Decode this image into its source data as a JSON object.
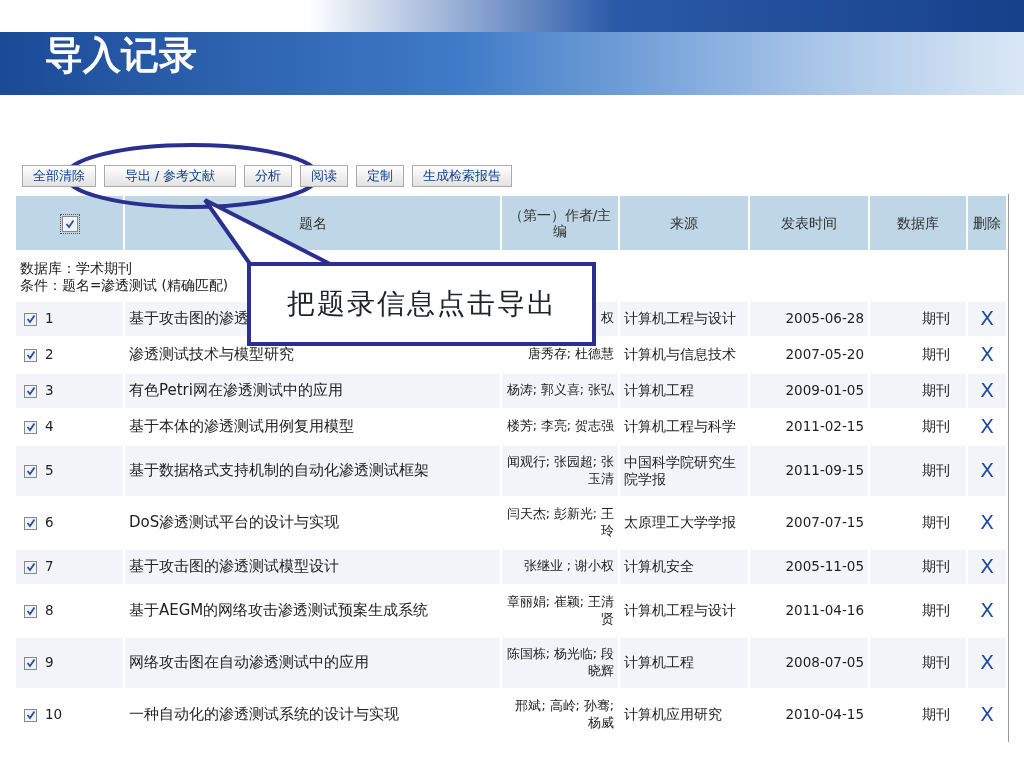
{
  "slide_title": "导入记录",
  "toolbar": {
    "buttons": [
      "全部清除",
      "导出 / 参考文献",
      "分析",
      "阅读",
      "定制",
      "生成检索报告"
    ]
  },
  "table": {
    "header_checkbox": {
      "checked": true
    },
    "columns": [
      "题名",
      "（第一）作者/主编",
      "来源",
      "发表时间",
      "数据库",
      "删除"
    ],
    "info": [
      "数据库：学术期刊",
      "条件：题名=渗透测试 (精确匹配)"
    ],
    "rows": [
      {
        "number": "1",
        "checked": true,
        "title": "基于攻击图的渗透",
        "author": "权",
        "source": "计算机工程与设计",
        "date": "2005-06-28",
        "database": "期刊",
        "delete": "X"
      },
      {
        "number": "2",
        "checked": true,
        "title": "渗透测试技术与模型研究",
        "author": "唐秀存; 杜德慧",
        "source": "计算机与信息技术",
        "date": "2007-05-20",
        "database": "期刊",
        "delete": "X"
      },
      {
        "number": "3",
        "checked": true,
        "title": "有色Petri网在渗透测试中的应用",
        "author": "杨涛; 郭义喜; 张弘",
        "source": "计算机工程",
        "date": "2009-01-05",
        "database": "期刊",
        "delete": "X"
      },
      {
        "number": "4",
        "checked": true,
        "title": "基于本体的渗透测试用例复用模型",
        "author": "楼芳; 李亮; 贺志强",
        "source": "计算机工程与科学",
        "date": "2011-02-15",
        "database": "期刊",
        "delete": "X"
      },
      {
        "number": "5",
        "checked": true,
        "title": "基于数据格式支持机制的自动化渗透测试框架",
        "author": "闻观行; 张园超; 张玉清",
        "source": "中国科学院研究生院学报",
        "date": "2011-09-15",
        "database": "期刊",
        "delete": "X"
      },
      {
        "number": "6",
        "checked": true,
        "title": "DoS渗透测试平台的设计与实现",
        "author": "闫天杰; 彭新光; 王玲",
        "source": "太原理工大学学报",
        "date": "2007-07-15",
        "database": "期刊",
        "delete": "X"
      },
      {
        "number": "7",
        "checked": true,
        "title": "基于攻击图的渗透测试模型设计",
        "author": "张继业 ; 谢小权",
        "source": "计算机安全",
        "date": "2005-11-05",
        "database": "期刊",
        "delete": "X"
      },
      {
        "number": "8",
        "checked": true,
        "title": "基于AEGM的网络攻击渗透测试预案生成系统",
        "author": "章丽娟; 崔颖; 王清贤",
        "source": "计算机工程与设计",
        "date": "2011-04-16",
        "database": "期刊",
        "delete": "X"
      },
      {
        "number": "9",
        "checked": true,
        "title": "网络攻击图在自动渗透测试中的应用",
        "author": "陈国栋; 杨光临; 段晓辉",
        "source": "计算机工程",
        "date": "2008-07-05",
        "database": "期刊",
        "delete": "X"
      },
      {
        "number": "10",
        "checked": true,
        "title": "一种自动化的渗透测试系统的设计与实现",
        "author": "邢斌; 高岭; 孙骞; 杨威",
        "source": "计算机应用研究",
        "date": "2010-04-15",
        "database": "期刊",
        "delete": "X"
      }
    ]
  },
  "callout": {
    "text": "把题录信息点击导出"
  }
}
